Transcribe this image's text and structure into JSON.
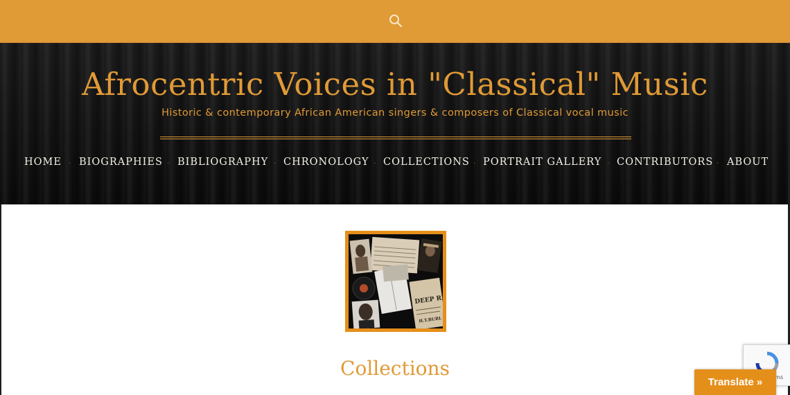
{
  "header": {
    "search_icon": "search-icon",
    "site_title": "Afrocentric Voices in \"Classical\" Music",
    "tagline": "Historic & contemporary African American singers & composers of Classical vocal music"
  },
  "nav": {
    "items": [
      {
        "label": "HOME"
      },
      {
        "label": "BIOGRAPHIES"
      },
      {
        "label": "BIBLIOGRAPHY"
      },
      {
        "label": "CHRONOLOGY"
      },
      {
        "label": "COLLECTIONS"
      },
      {
        "label": "PORTRAIT GALLERY"
      },
      {
        "label": "CONTRIBUTORS"
      },
      {
        "label": "ABOUT"
      }
    ]
  },
  "main": {
    "collage_text": {
      "sheet_title": "DEEP RI",
      "sheet_sub": "H.T.BURL"
    },
    "heading": "Collections"
  },
  "recaptcha": {
    "text": "rms"
  },
  "translate": {
    "label": "Translate »"
  },
  "colors": {
    "accent": "#e09a36",
    "nav_text": "#f3efe6",
    "hero_bg": "#0b0b0b",
    "button": "#e58f1b"
  }
}
